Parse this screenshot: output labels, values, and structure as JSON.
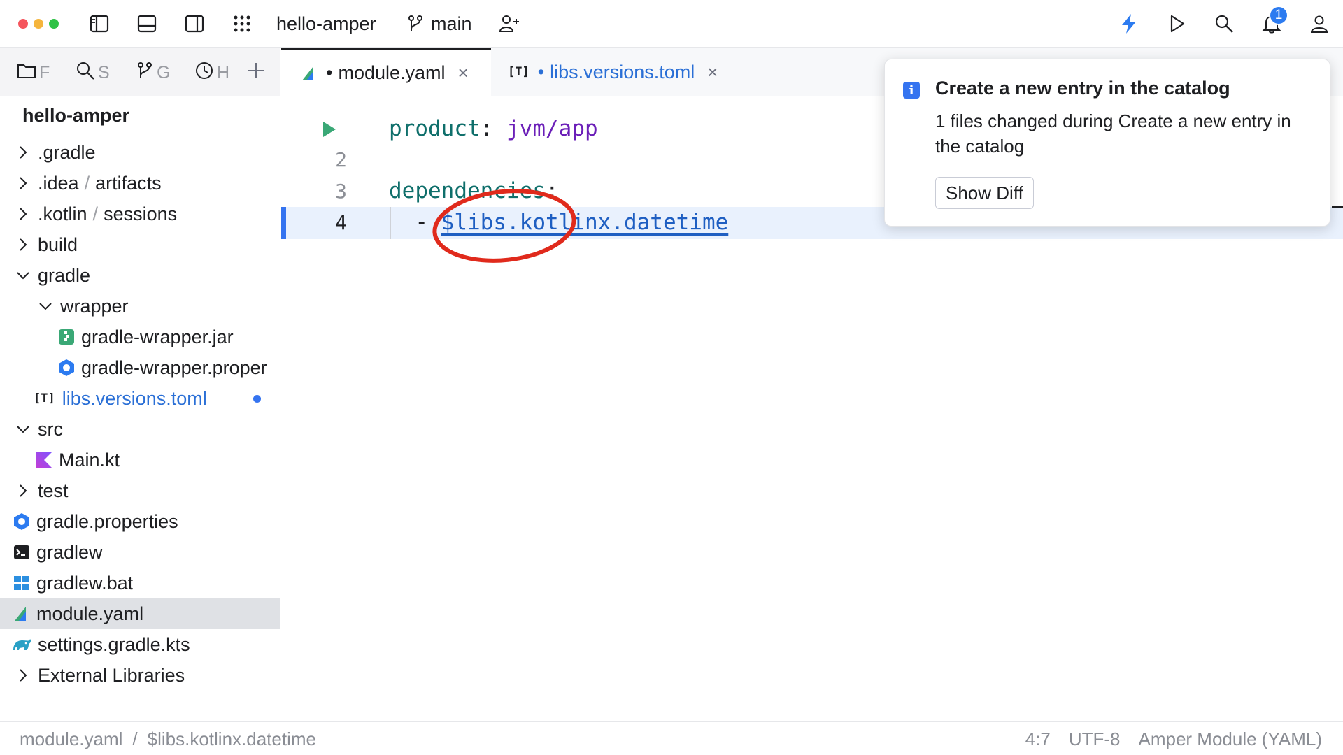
{
  "titlebar": {
    "project_name": "hello-amper",
    "branch": "main",
    "notifications_count": "1"
  },
  "sidebar": {
    "tabs": [
      {
        "label": "F",
        "icon": "folder-icon"
      },
      {
        "label": "S",
        "icon": "search-icon"
      },
      {
        "label": "G",
        "icon": "branch-icon"
      },
      {
        "label": "H",
        "icon": "history-icon"
      }
    ],
    "project_title": "hello-amper",
    "tree": [
      {
        "name": ".gradle",
        "suffix": ""
      },
      {
        "name": ".idea",
        "suffix": "artifacts"
      },
      {
        "name": ".kotlin",
        "suffix": "sessions"
      },
      {
        "name": "build",
        "suffix": ""
      },
      {
        "name": "gradle",
        "suffix": ""
      },
      {
        "name": "wrapper",
        "suffix": ""
      },
      {
        "name": "gradle-wrapper.jar",
        "suffix": ""
      },
      {
        "name": "gradle-wrapper.proper",
        "suffix": ""
      },
      {
        "name": "libs.versions.toml",
        "suffix": ""
      },
      {
        "name": "src",
        "suffix": ""
      },
      {
        "name": "Main.kt",
        "suffix": ""
      },
      {
        "name": "test",
        "suffix": ""
      },
      {
        "name": "gradle.properties",
        "suffix": ""
      },
      {
        "name": "gradlew",
        "suffix": ""
      },
      {
        "name": "gradlew.bat",
        "suffix": ""
      },
      {
        "name": "module.yaml",
        "suffix": ""
      },
      {
        "name": "settings.gradle.kts",
        "suffix": ""
      },
      {
        "name": "External Libraries",
        "suffix": ""
      }
    ],
    "path_separator": "/",
    "toml_badge": "[T]"
  },
  "editor": {
    "tabs": [
      {
        "label": "module.yaml",
        "modified": "•",
        "close": "×"
      },
      {
        "label": "libs.versions.toml",
        "badge": "[T]",
        "modified": "•",
        "close": "×"
      }
    ],
    "lines": {
      "l1_key": "product",
      "l1_colon": ":",
      "l1_value": "jvm/app",
      "l2_num": "2",
      "l3_num": "3",
      "l3_key": "dependencies",
      "l3_colon": ":",
      "l4_num": "4",
      "l4_dash": "-",
      "l4_value": "$libs.kotlinx.datetime"
    }
  },
  "notification": {
    "icon": "info-icon",
    "title": "Create a new entry in the catalog",
    "body": "1 files changed during Create a new entry in the catalog",
    "button": "Show Diff"
  },
  "statusbar": {
    "file": "module.yaml",
    "separator": "/",
    "symbol": "$libs.kotlinx.datetime",
    "position": "4:7",
    "encoding": "UTF-8",
    "file_type": "Amper Module (YAML)"
  },
  "colors": {
    "accent": "#3574f0",
    "annotation_circle": "#e02a1c"
  }
}
